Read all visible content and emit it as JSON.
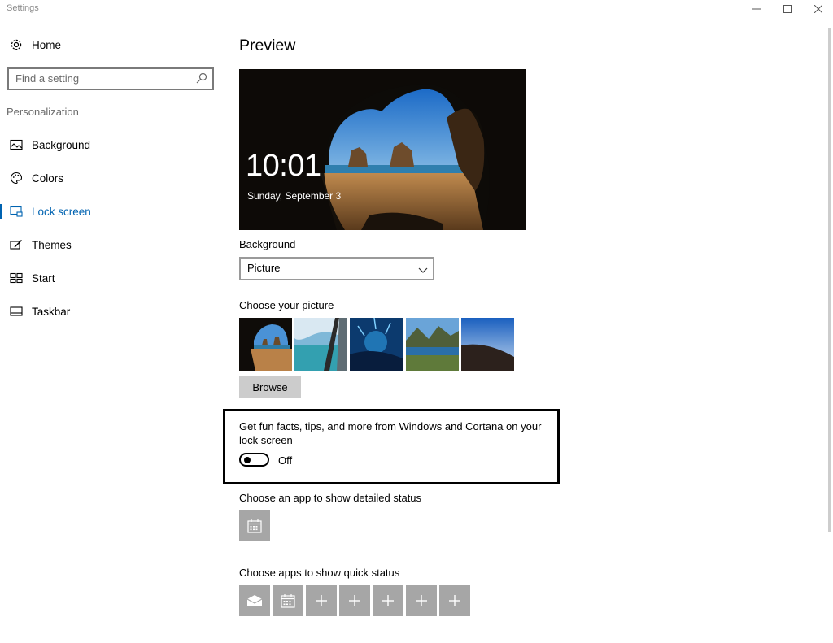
{
  "window": {
    "title": "Settings",
    "controls": {
      "minimize_icon": "minimize-icon",
      "maximize_icon": "maximize-icon",
      "close_icon": "close-icon"
    }
  },
  "sidebar": {
    "home_label": "Home",
    "search": {
      "placeholder": "Find a setting",
      "icon": "search-icon"
    },
    "section_label": "Personalization",
    "items": [
      {
        "label": "Background",
        "icon": "picture-icon",
        "selected": false
      },
      {
        "label": "Colors",
        "icon": "palette-icon",
        "selected": false
      },
      {
        "label": "Lock screen",
        "icon": "lock-screen-icon",
        "selected": true
      },
      {
        "label": "Themes",
        "icon": "themes-icon",
        "selected": false
      },
      {
        "label": "Start",
        "icon": "start-icon",
        "selected": false
      },
      {
        "label": "Taskbar",
        "icon": "taskbar-icon",
        "selected": false
      }
    ],
    "accent_color": "#0063b1"
  },
  "main": {
    "page_title": "Preview",
    "preview": {
      "time": "10:01",
      "date": "Sunday, September 3"
    },
    "background": {
      "label": "Background",
      "selected": "Picture"
    },
    "choose_picture": {
      "label": "Choose your picture",
      "browse_label": "Browse"
    },
    "tips": {
      "text": "Get fun facts, tips, and more from Windows and Cortana on your lock screen",
      "toggle_state": "Off",
      "toggle_on": false
    },
    "detailed_status": {
      "label": "Choose an app to show detailed status",
      "app_icon": "calendar-icon"
    },
    "quick_status": {
      "label": "Choose apps to show quick status",
      "apps": [
        "mail-icon",
        "calendar-icon",
        "plus-icon",
        "plus-icon",
        "plus-icon",
        "plus-icon",
        "plus-icon"
      ]
    }
  }
}
